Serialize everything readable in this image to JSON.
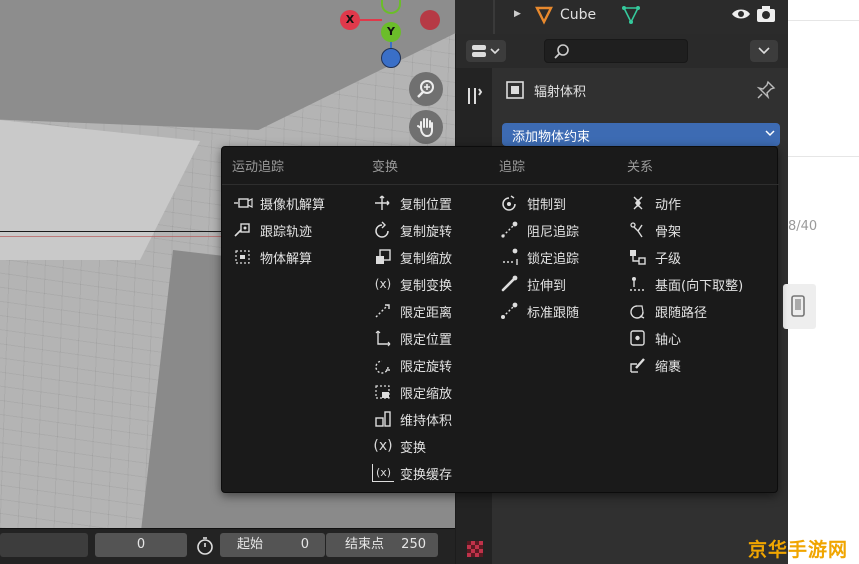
{
  "viewport": {
    "gizmo": {
      "x": "X",
      "y": "Y"
    }
  },
  "timeline": {
    "current_frame": "0",
    "start_label": "起始",
    "start_value": "0",
    "end_label": "结束点",
    "end_value": "250"
  },
  "outliner": {
    "object_name": "Cube"
  },
  "properties": {
    "section_title": "辐射体积",
    "add_constraint_label": "添加物体约束",
    "search_placeholder": ""
  },
  "menu": {
    "columns": [
      {
        "header": "运动追踪",
        "items": [
          {
            "label": "摄像机解算",
            "icon": "camera-solver-icon"
          },
          {
            "label": "跟踪轨迹",
            "icon": "follow-track-icon"
          },
          {
            "label": "物体解算",
            "icon": "object-solver-icon"
          }
        ]
      },
      {
        "header": "变换",
        "items": [
          {
            "label": "复制位置",
            "icon": "copy-location-icon"
          },
          {
            "label": "复制旋转",
            "icon": "copy-rotation-icon"
          },
          {
            "label": "复制缩放",
            "icon": "copy-scale-icon"
          },
          {
            "label": "复制变换",
            "icon": "copy-transforms-icon"
          },
          {
            "label": "限定距离",
            "icon": "limit-distance-icon"
          },
          {
            "label": "限定位置",
            "icon": "limit-location-icon"
          },
          {
            "label": "限定旋转",
            "icon": "limit-rotation-icon"
          },
          {
            "label": "限定缩放",
            "icon": "limit-scale-icon"
          },
          {
            "label": "维持体积",
            "icon": "maintain-volume-icon"
          },
          {
            "label": "变换",
            "icon": "transformation-icon"
          },
          {
            "label": "变换缓存",
            "icon": "transform-cache-icon"
          }
        ]
      },
      {
        "header": "追踪",
        "items": [
          {
            "label": "钳制到",
            "icon": "clamp-to-icon"
          },
          {
            "label": "阻尼追踪",
            "icon": "damped-track-icon"
          },
          {
            "label": "锁定追踪",
            "icon": "locked-track-icon"
          },
          {
            "label": "拉伸到",
            "icon": "stretch-to-icon"
          },
          {
            "label": "标准跟随",
            "icon": "track-to-icon"
          }
        ]
      },
      {
        "header": "关系",
        "items": [
          {
            "label": "动作",
            "icon": "action-icon"
          },
          {
            "label": "骨架",
            "icon": "armature-icon"
          },
          {
            "label": "子级",
            "icon": "child-of-icon"
          },
          {
            "label": "基面(向下取整)",
            "icon": "floor-icon"
          },
          {
            "label": "跟随路径",
            "icon": "follow-path-icon"
          },
          {
            "label": "轴心",
            "icon": "pivot-icon"
          },
          {
            "label": "缩裹",
            "icon": "shrinkwrap-icon"
          }
        ]
      }
    ]
  },
  "side_panel": {
    "counter": "8/40"
  },
  "watermark": "京华手游网",
  "colors": {
    "accent_blue": "#3d6bb3",
    "menu_bg": "#1a1a1a",
    "axis_x": "#e0394b",
    "axis_y": "#6bbd2a",
    "axis_z": "#3a6fc7",
    "watermark": "#f0a500"
  }
}
